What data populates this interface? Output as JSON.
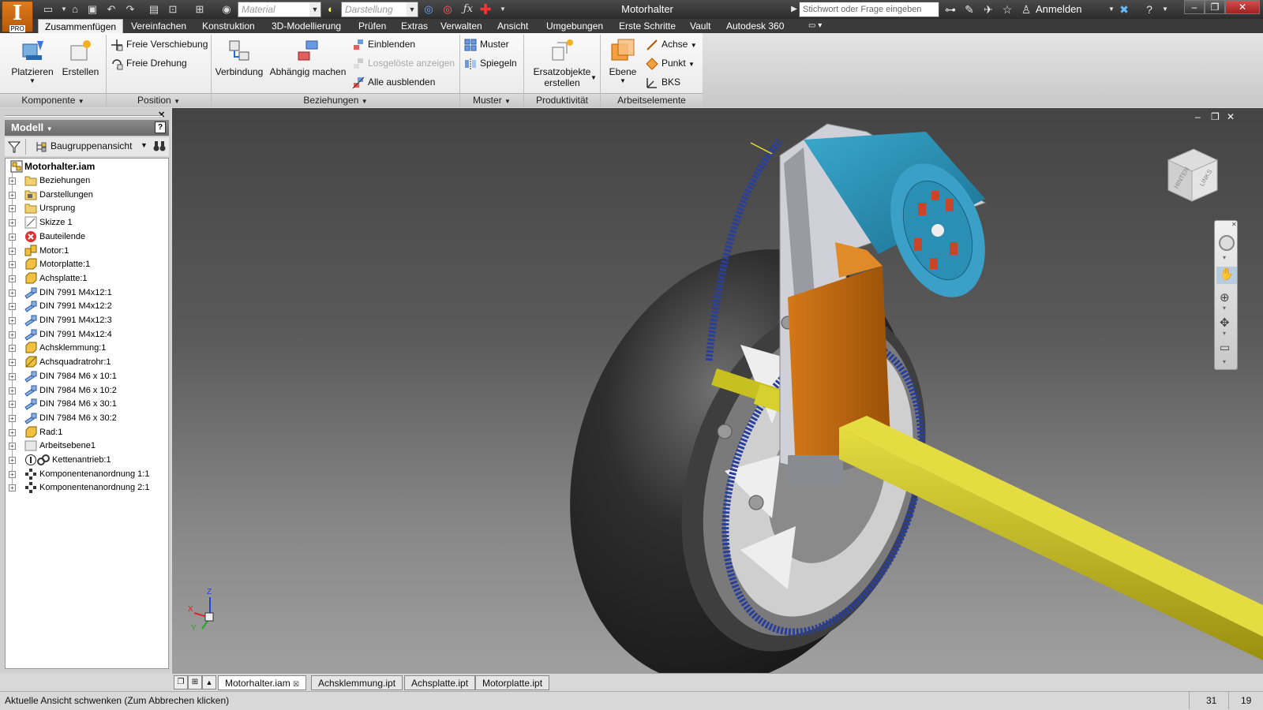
{
  "app": {
    "badge": "PRO",
    "letter": "I"
  },
  "qat": {
    "material_placeholder": "Material",
    "appearance_placeholder": "Darstellung"
  },
  "window_title": "Motorhalter",
  "search": {
    "placeholder": "Stichwort oder Frage eingeben"
  },
  "account": {
    "signin": "Anmelden"
  },
  "menu_tabs": [
    "Zusammenfügen",
    "Vereinfachen",
    "Konstruktion",
    "3D-Modellierung",
    "Prüfen",
    "Extras",
    "Verwalten",
    "Ansicht",
    "Umgebungen",
    "Erste Schritte",
    "Vault",
    "Autodesk 360"
  ],
  "ribbon": {
    "komponente": {
      "label": "Komponente",
      "platzieren": "Platzieren",
      "erstellen": "Erstellen"
    },
    "position": {
      "label": "Position",
      "freie_verschiebung": "Freie Verschiebung",
      "freie_drehung": "Freie Drehung"
    },
    "beziehungen": {
      "label": "Beziehungen",
      "verbindung": "Verbindung",
      "abhaengig": "Abhängig machen",
      "einblenden": "Einblenden",
      "losgeloeste": "Losgelöste anzeigen",
      "alle_ausblenden": "Alle ausblenden"
    },
    "muster": {
      "label": "Muster",
      "muster": "Muster",
      "spiegeln": "Spiegeln"
    },
    "produktivitaet": {
      "label": "Produktivität",
      "ersatz1": "Ersatzobjekte",
      "ersatz2": "erstellen"
    },
    "arbeitselemente": {
      "label": "Arbeitselemente",
      "ebene": "Ebene",
      "achse": "Achse",
      "punkt": "Punkt",
      "bks": "BKS"
    }
  },
  "browser": {
    "title": "Modell",
    "help": "?",
    "view": "Baugruppenansicht",
    "root": "Motorhalter.iam",
    "nodes": [
      {
        "label": "Beziehungen",
        "icon": "folder-rel"
      },
      {
        "label": "Darstellungen",
        "icon": "folder-rep"
      },
      {
        "label": "Ursprung",
        "icon": "folder"
      },
      {
        "label": "Skizze 1",
        "icon": "sketch"
      },
      {
        "label": "Bauteilende",
        "icon": "end"
      },
      {
        "label": "Motor:1",
        "icon": "assembly"
      },
      {
        "label": "Motorplatte:1",
        "icon": "part"
      },
      {
        "label": "Achsplatte:1",
        "icon": "part"
      },
      {
        "label": "DIN 7991 M4x12:1",
        "icon": "bolt"
      },
      {
        "label": "DIN 7991 M4x12:2",
        "icon": "bolt"
      },
      {
        "label": "DIN 7991 M4x12:3",
        "icon": "bolt"
      },
      {
        "label": "DIN 7991 M4x12:4",
        "icon": "bolt"
      },
      {
        "label": "Achsklemmung:1",
        "icon": "part"
      },
      {
        "label": "Achsquadratrohr:1",
        "icon": "frame"
      },
      {
        "label": "DIN 7984 M6 x 10:1",
        "icon": "bolt"
      },
      {
        "label": "DIN 7984 M6 x 10:2",
        "icon": "bolt"
      },
      {
        "label": "DIN 7984 M6 x 30:1",
        "icon": "bolt"
      },
      {
        "label": "DIN 7984 M6 x 30:2",
        "icon": "bolt"
      },
      {
        "label": "Rad:1",
        "icon": "part"
      },
      {
        "label": "Arbeitsebene1",
        "icon": "plane"
      },
      {
        "label": "Kettenantrieb:1",
        "icon": "chain"
      },
      {
        "label": "Komponentenanordnung 1:1",
        "icon": "pattern"
      },
      {
        "label": "Komponentenanordnung 2:1",
        "icon": "pattern"
      }
    ]
  },
  "viewcube": {
    "face1": "HINTEN",
    "face2": "LINKS"
  },
  "triad": {
    "x": "X",
    "y": "Y",
    "z": "Z"
  },
  "doc_tabs": [
    "Motorhalter.iam",
    "Achsklemmung.ipt",
    "Achsplatte.ipt",
    "Motorplatte.ipt"
  ],
  "status": {
    "text": "Aktuelle Ansicht schwenken (Zum Abbrechen klicken)",
    "num1": "31",
    "num2": "19"
  },
  "colors": {
    "motor": "#2a8fb3",
    "plate": "#c06a10",
    "tube": "#c8c020",
    "wheel": "#2a2a2a",
    "chain": "#2a3f9a"
  }
}
